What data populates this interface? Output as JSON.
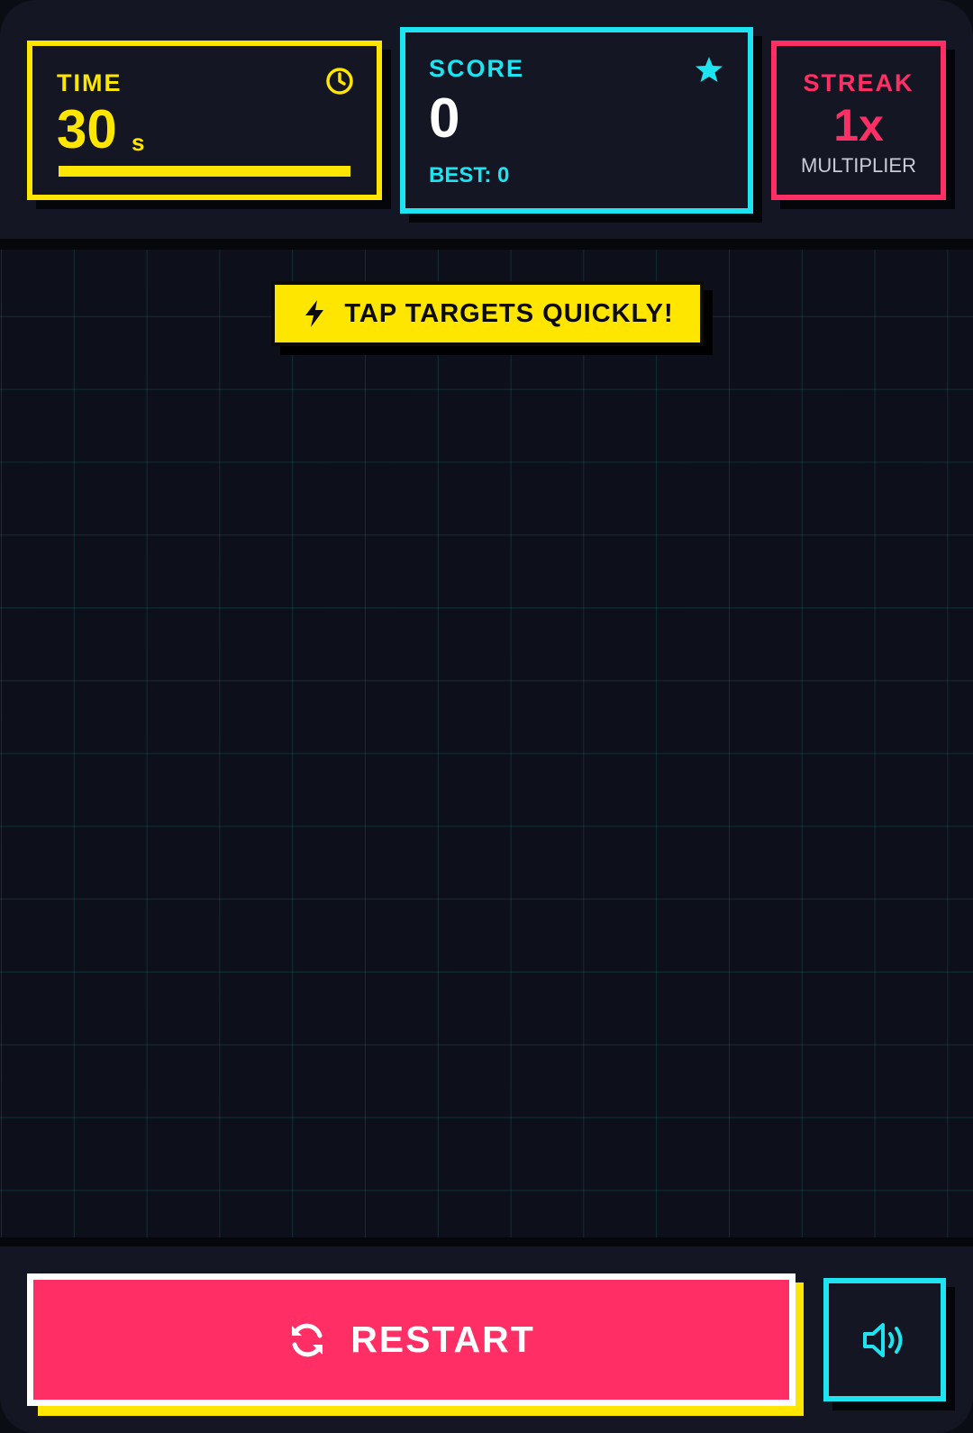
{
  "stats": {
    "time": {
      "label": "TIME",
      "value": "30",
      "unit": "s",
      "progress_fraction": 1.0,
      "icon": "clock-icon"
    },
    "score": {
      "label": "SCORE",
      "value": "0",
      "best": "BEST: 0",
      "icon": "star-icon"
    },
    "streak": {
      "label": "STREAK",
      "value": "1x",
      "sub": "MULTIPLIER"
    }
  },
  "field": {
    "hint": "TAP TARGETS QUICKLY!",
    "hint_icon": "bolt-icon"
  },
  "controls": {
    "restart_label": "RESTART",
    "restart_icon": "refresh-icon",
    "sound_icon": "speaker-icon"
  },
  "colors": {
    "yellow": "#ffe600",
    "cyan": "#1ee3f0",
    "pink": "#ff2f66",
    "background": "#0d0f1a",
    "panel": "#141723"
  }
}
